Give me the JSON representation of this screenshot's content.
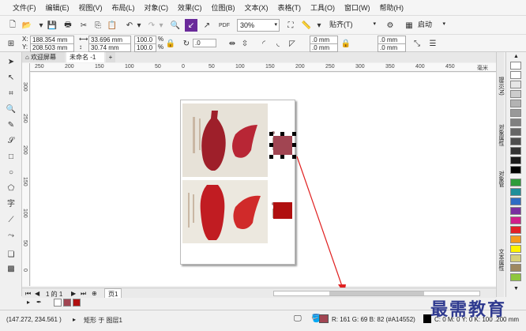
{
  "menu": [
    "文件(F)",
    "编辑(E)",
    "视图(V)",
    "布局(L)",
    "对象(C)",
    "效果(C)",
    "位图(B)",
    "文本(X)",
    "表格(T)",
    "工具(O)",
    "窗口(W)",
    "帮助(H)"
  ],
  "toolbar": {
    "zoom": "30%",
    "snap": "贴齐(T)",
    "launch": "启动"
  },
  "props": {
    "x": "188.354 mm",
    "y": "208.503 mm",
    "w": "33.696 mm",
    "h": "30.74 mm",
    "sx": "100.0",
    "sy": "100.0",
    "pct": "%",
    "angle": ".0",
    "c1": ".0 mm",
    "c2": ".0 mm",
    "c3": ".0 mm",
    "c4": ".0 mm",
    "x_lbl": "X:",
    "y_lbl": "Y:"
  },
  "tabs": {
    "welcome": "欢迎屏幕",
    "doc": "未命名 -1",
    "add": "+"
  },
  "hruler_ticks": [
    "250",
    "200",
    "150",
    "100",
    "50",
    "0",
    "50",
    "100",
    "150",
    "200",
    "250",
    "300",
    "350",
    "400",
    "450"
  ],
  "hruler_unit": "毫米",
  "vruler_ticks": [
    "300",
    "250",
    "200",
    "150",
    "100",
    "50",
    "0"
  ],
  "dock": {
    "hint": "提示(N)",
    "obj_props": "对象属性",
    "obj_mgr": "对象管",
    "text_props": "文本属性"
  },
  "pagenav": {
    "pages": "1 的 1",
    "page": "页1"
  },
  "status": {
    "coords": "(147.272, 234.561 )",
    "info": "矩形 于 图层1",
    "fill": "R: 161 G: 69 B: 82 (#A14552)",
    "outline": "C: 0 M: 0 Y: 0 K: 100  .200 mm"
  },
  "watermark": "最需教育",
  "colors": {
    "selected": "#a14552",
    "red": "#b01010"
  }
}
